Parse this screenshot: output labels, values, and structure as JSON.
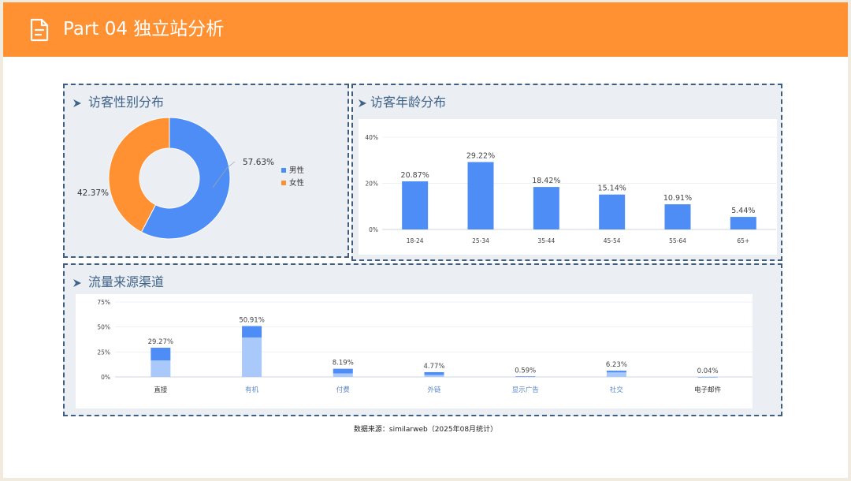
{
  "header": {
    "title": "Part 04 独立站分析",
    "icon": "document-icon"
  },
  "gender_panel": {
    "title": "访客性别分布"
  },
  "age_panel": {
    "title": "访客年龄分布"
  },
  "traffic_panel": {
    "title": "流量来源渠道"
  },
  "source_note": "数据来源：similarweb（2025年08月统计）",
  "colors": {
    "header": "#ff9132",
    "blue": "#4e8cf6",
    "orange": "#ff9132",
    "light_blue": "#a9c9fb",
    "panel_border": "#3f5d7c"
  },
  "chart_data": [
    {
      "id": "gender",
      "type": "pie",
      "categories": [
        "男性",
        "女性"
      ],
      "values": [
        57.63,
        42.37
      ],
      "labels": [
        "57.63%",
        "42.37%"
      ],
      "colors": [
        "#4e8cf6",
        "#ff9132"
      ],
      "donut": true,
      "legend": "right"
    },
    {
      "id": "age",
      "type": "bar",
      "categories": [
        "18-24",
        "25-34",
        "35-44",
        "45-54",
        "55-64",
        "65+"
      ],
      "values": [
        20.87,
        29.22,
        18.42,
        15.14,
        10.91,
        5.44
      ],
      "labels": [
        "20.87%",
        "29.22%",
        "18.42%",
        "15.14%",
        "10.91%",
        "5.44%"
      ],
      "yticks": [
        "0%",
        "20%",
        "40%"
      ],
      "ylim": [
        0,
        40
      ],
      "grid": true,
      "color": "#4e8cf6"
    },
    {
      "id": "traffic",
      "type": "bar",
      "stacked": true,
      "categories": [
        "直接",
        "有机",
        "付费",
        "外链",
        "显示广告",
        "社交",
        "电子邮件"
      ],
      "values": [
        29.27,
        50.91,
        8.19,
        4.77,
        0.59,
        6.23,
        0.04
      ],
      "labels": [
        "29.27%",
        "50.91%",
        "8.19%",
        "4.77%",
        "0.59%",
        "6.23%",
        "0.04%"
      ],
      "lower_values": [
        16.5,
        39.5,
        3.5,
        2,
        0.2,
        4.5,
        0
      ],
      "yticks": [
        "0%",
        "25%",
        "50%",
        "75%"
      ],
      "ylim": [
        0,
        75
      ],
      "grid": true,
      "colors": {
        "lower": "#a9c9fb",
        "upper": "#4e8cf6"
      }
    }
  ]
}
